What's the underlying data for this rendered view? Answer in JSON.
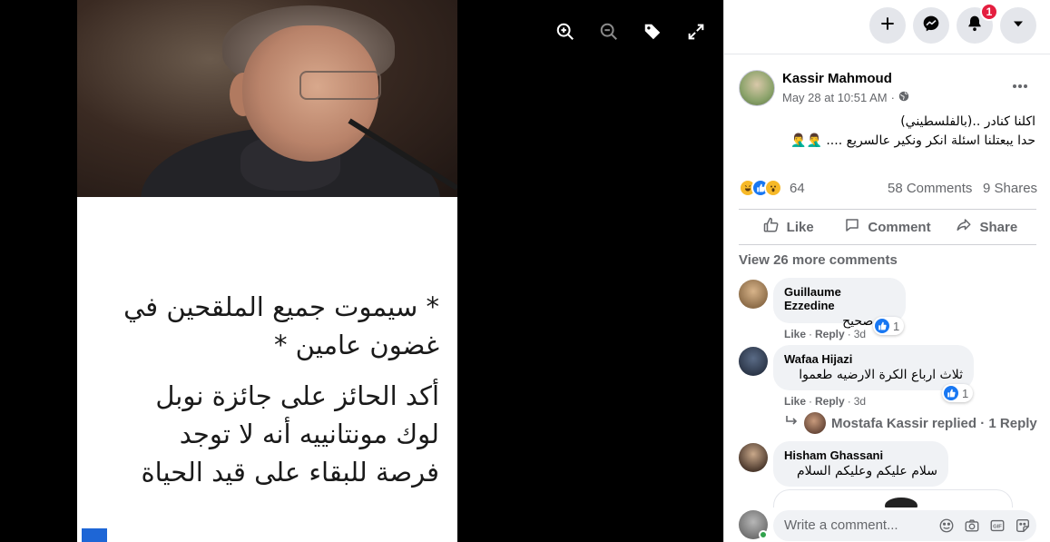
{
  "viewer": {
    "photo_text": [
      "* سيموت جميع الملقحين في",
      "غضون عامين *",
      "أكد الحائز على جائزة نوبل",
      "لوك مونتانييه أنه لا توجد",
      "فرصة للبقاء على قيد الحياة"
    ],
    "controls": [
      "zoom-in-icon",
      "zoom-out-icon",
      "tag-icon",
      "fullscreen-icon"
    ]
  },
  "topbar": {
    "buttons": [
      "plus-icon",
      "messenger-icon",
      "bell-icon",
      "caret-down-icon"
    ],
    "notification_count": "1"
  },
  "post": {
    "author": "Kassir Mahmoud",
    "timestamp": "May 28 at 10:51 AM",
    "separator": "·",
    "audience_icon": "globe-icon",
    "text_line1": "اكلنا كنادر ..(بالفلسطيني)",
    "text_line2": "حدا يبعتلنا اسئلة انكر ونكير عالسريع .... 🤦‍♂️🤦‍♂️",
    "reactions": {
      "icons": [
        "haha-reaction",
        "like-reaction",
        "wow-reaction"
      ],
      "count": "64"
    },
    "comments_count": "58 Comments",
    "shares_count": "9 Shares",
    "actions": {
      "like": "Like",
      "comment": "Comment",
      "share": "Share"
    }
  },
  "comments": {
    "view_more": "View 26 more comments",
    "items": [
      {
        "name": "Guillaume Ezzedine",
        "text": "غير صحيح",
        "like_label": "Like",
        "reply_label": "Reply",
        "age": "3d",
        "reaction_count": "1"
      },
      {
        "name": "Wafaa Hijazi",
        "text": "ثلاث ارباع الكرة الارضيه طعموا",
        "like_label": "Like",
        "reply_label": "Reply",
        "age": "3d",
        "reaction_count": "1"
      },
      {
        "name": "Hisham Ghassani",
        "text": "سلام عليكم وعليكم السلام"
      }
    ],
    "reply_summary": "Mostafa Kassir replied · 1 Reply"
  },
  "composer": {
    "placeholder": "Write a comment...",
    "icons": [
      "emoji-icon",
      "camera-icon",
      "gif-icon",
      "sticker-icon"
    ]
  },
  "colors": {
    "facebook_blue": "#1877f2",
    "notification_red": "#e41e3f",
    "secondary_text": "#65676b",
    "bubble_bg": "#f0f2f5"
  }
}
